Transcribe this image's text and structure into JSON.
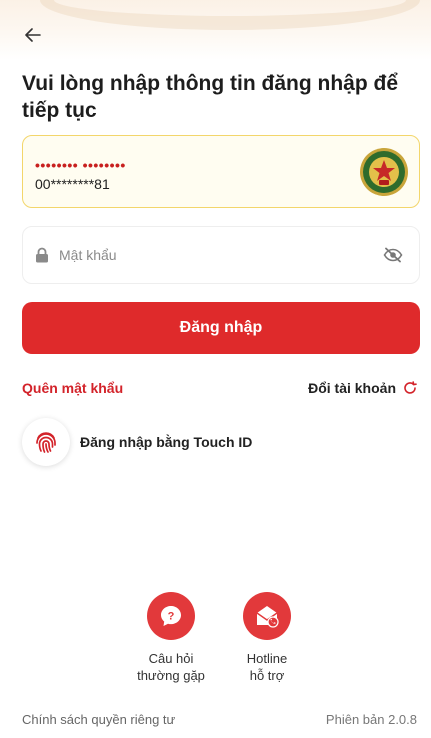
{
  "header": {
    "title": "Vui lòng nhập thông tin đăng nhập để tiếp tục"
  },
  "account": {
    "masked_name": "•••••••• ••••••••",
    "masked_id": "00********81"
  },
  "password": {
    "placeholder": "Mật khẩu",
    "value": ""
  },
  "actions": {
    "login_label": "Đăng nhập",
    "forgot_label": "Quên mật khẩu",
    "switch_label": "Đổi tài khoản",
    "touch_id_label": "Đăng nhập bằng Touch ID"
  },
  "help": {
    "faq_line1": "Câu hỏi",
    "faq_line2": "thường gặp",
    "hotline_line1": "Hotline",
    "hotline_line2": "hỗ trợ"
  },
  "footer": {
    "privacy": "Chính sách quyền riêng tư",
    "version": "Phiên bản 2.0.8"
  },
  "colors": {
    "primary_red": "#df2a2b",
    "account_border": "#f3d66b",
    "account_bg": "#fffdf1"
  },
  "icons": {
    "back": "arrow-left-icon",
    "lock": "lock-icon",
    "eye": "eye-off-icon",
    "refresh": "refresh-icon",
    "fingerprint": "fingerprint-icon",
    "faq": "question-icon",
    "hotline": "phone-envelope-icon",
    "emblem": "police-emblem-icon"
  }
}
